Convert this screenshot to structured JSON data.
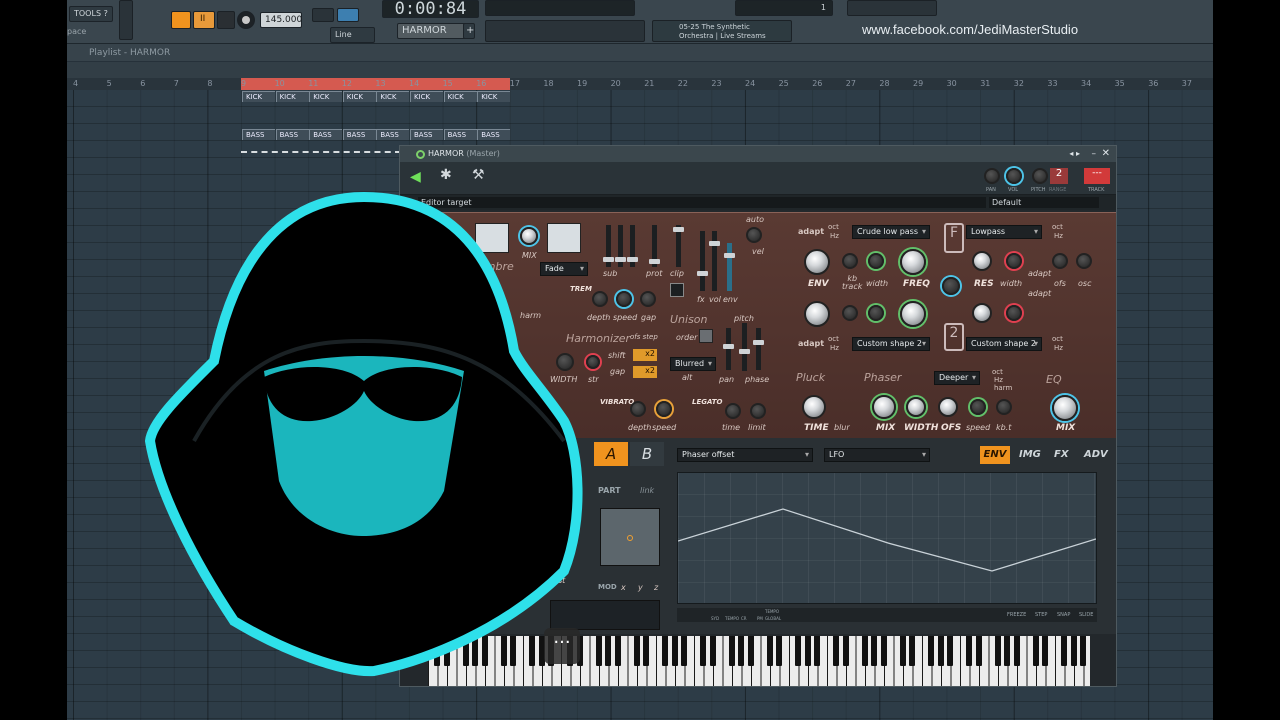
{
  "toolbar": {
    "tools_label": "TOOLS",
    "tools_help": "?",
    "space_label": "pace",
    "tempo": "145.000",
    "time": "0:00:84",
    "line_mode": "Line",
    "pattern": "HARMOR",
    "pattern_add": "+",
    "hint_line1": "05-25  The Synthetic",
    "hint_line2": "Orchestra | Live Streams",
    "cpu_value": "1"
  },
  "watermark": "www.facebook.com/JediMasterStudio",
  "playlist": {
    "title": "Playlist - HARMOR",
    "ruler": [
      "4",
      "5",
      "6",
      "7",
      "8",
      "9",
      "10",
      "11",
      "12",
      "13",
      "14",
      "15",
      "16",
      "17",
      "18",
      "19",
      "20",
      "21",
      "22",
      "23",
      "24",
      "25",
      "26",
      "27",
      "28",
      "29",
      "30",
      "31",
      "32",
      "33",
      "34",
      "35",
      "36",
      "37"
    ],
    "kick_label": "KICK",
    "bass_label": "BASS"
  },
  "plugin": {
    "title": "HARMOR",
    "title_suffix": "(Master)",
    "editor_target": "Editor target",
    "preset": "Default",
    "pitch_range": "2",
    "track": "---",
    "header_labels": {
      "pan": "PAN",
      "vol": "VOL",
      "pitch": "PITCH",
      "range": "RANGE",
      "track": "TRACK"
    },
    "timbre": {
      "label": "Timbre",
      "mix": "MIX",
      "fade": "Fade",
      "auto": "auto",
      "vel": "vel",
      "sub": "sub",
      "prot": "prot",
      "clip": "clip",
      "fx": "fx",
      "vol": "vol",
      "env": "env"
    },
    "trem": {
      "label": "TREM",
      "depth": "depth",
      "speed": "speed",
      "gap": "gap",
      "harm": "harm"
    },
    "unison": {
      "label": "Unison",
      "pitch": "pitch",
      "order": "order",
      "mode": "Blurred",
      "alt": "alt",
      "pan": "pan",
      "phase": "phase"
    },
    "harmonizer": {
      "label": "Harmonizer",
      "ofs_step": "ofs step",
      "shift": "shift",
      "gap": "gap",
      "shift_val": "x2",
      "gap_val": "x2",
      "width": "WIDTH",
      "str": "str"
    },
    "vibrato": {
      "label": "VIBRATO",
      "depth": "depth",
      "speed": "speed"
    },
    "legato": {
      "label": "LEGATO",
      "time": "time",
      "limit": "limit"
    },
    "filter1": {
      "adapt": "adapt",
      "oct": "oct",
      "hz": "Hz",
      "type": "Crude low pass",
      "env": "ENV",
      "kb_track": "kb\ntrack",
      "width": "width",
      "freq": "FREQ"
    },
    "filter2": {
      "adapt": "adapt",
      "oct": "oct",
      "hz": "Hz",
      "type": "Custom shape 2"
    },
    "res1": {
      "type": "Lowpass",
      "oct": "oct",
      "hz": "Hz",
      "res": "RES",
      "width": "width",
      "adapt": "adapt",
      "ofs": "ofs",
      "osc": "osc"
    },
    "res2": {
      "type": "Custom shape 2",
      "oct": "oct",
      "hz": "Hz",
      "adapt": "adapt"
    },
    "pluck": {
      "label": "Pluck",
      "time": "TIME",
      "blur": "blur"
    },
    "phaser": {
      "label": "Phaser",
      "mode": "Deeper",
      "oct": "oct",
      "hz": "Hz",
      "harm": "harm",
      "mix": "MIX",
      "width": "WIDTH",
      "ofs": "OFS",
      "speed": "speed",
      "kbt": "kb.t"
    },
    "eq": {
      "label": "EQ",
      "mix": "MIX"
    },
    "lower": {
      "tab_a": "A",
      "tab_b": "B",
      "part": "PART",
      "link": "link",
      "mod": "MOD",
      "x": "x",
      "y": "y",
      "z": "z",
      "post": "post",
      "env_target": "Phaser offset",
      "env_source": "LFO",
      "tabs": [
        "ENV",
        "IMG",
        "FX",
        "ADV"
      ],
      "bottom_left": [
        "SYD",
        "TEMPO",
        "CR",
        "PM"
      ],
      "bottom_flags": [
        "TEMPO",
        "GLOBAL"
      ],
      "bottom_right": [
        "FREEZE",
        "STEP",
        "SNAP",
        "SLIDE"
      ]
    }
  },
  "overlay": {
    "more": "···"
  },
  "colors": {
    "accent_cyan": "#2fd4e0",
    "loop_red": "#d55a50",
    "panel_brown": "#5a3a33",
    "tab_orange": "#f0931e"
  }
}
